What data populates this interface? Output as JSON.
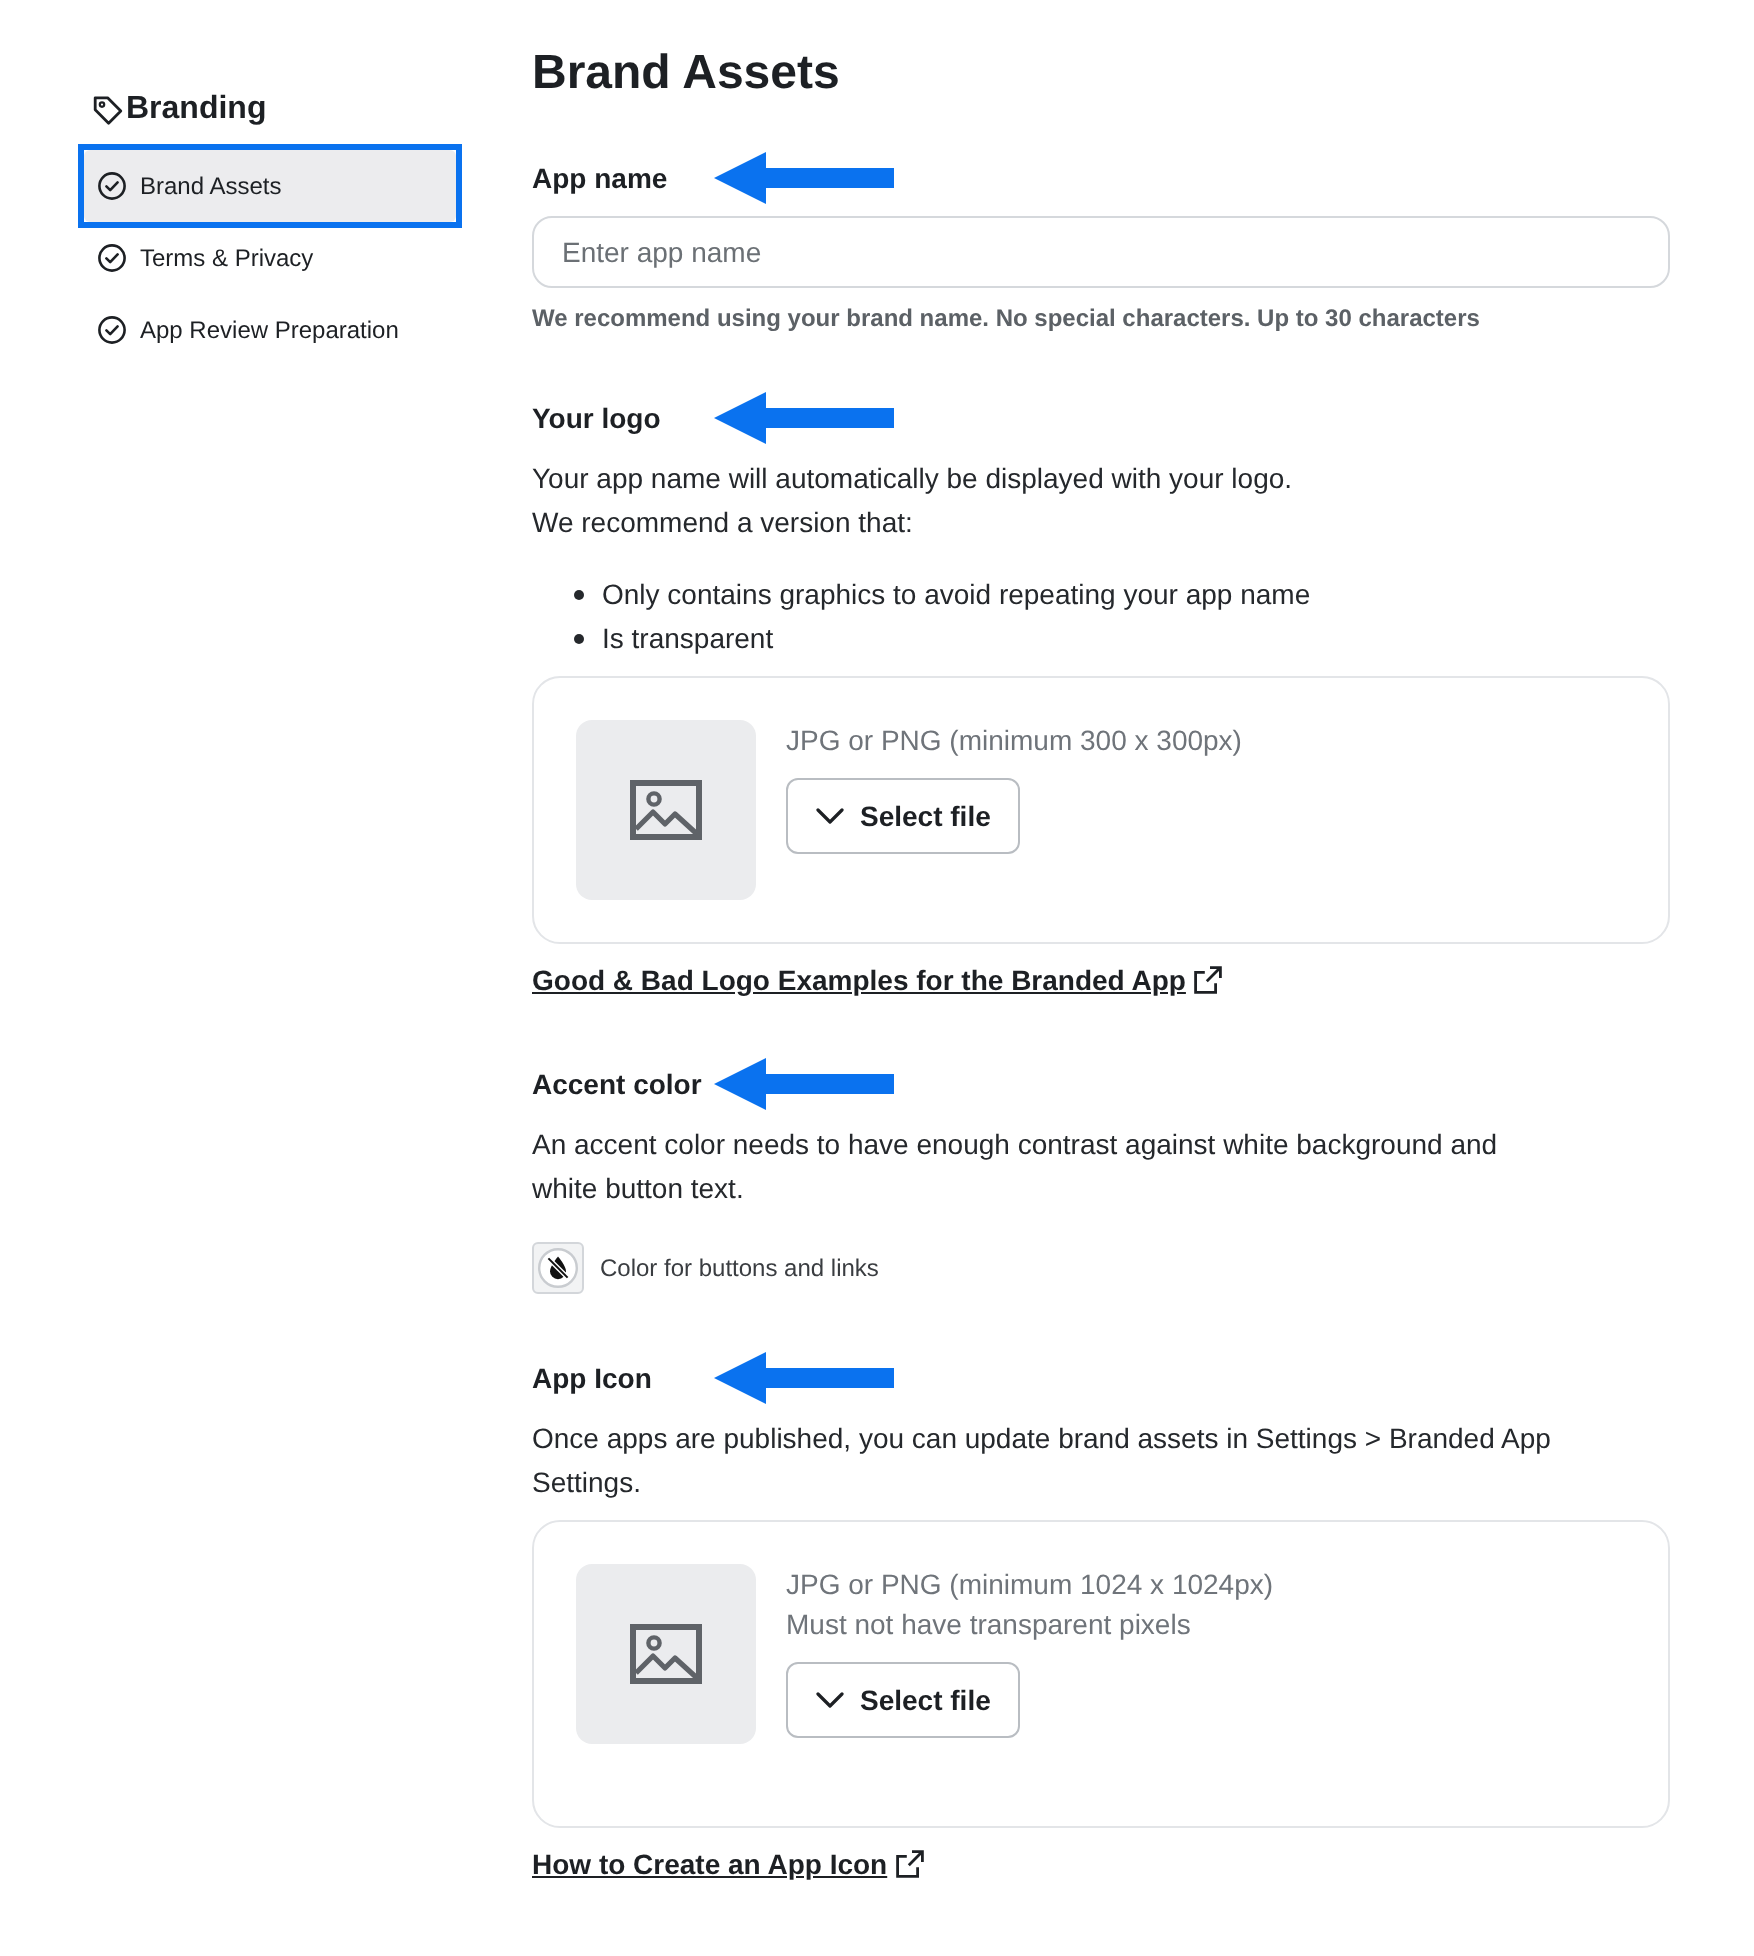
{
  "sidebar": {
    "title": "Branding",
    "items": [
      {
        "label": "Brand Assets",
        "selected": true,
        "highlighted": true
      },
      {
        "label": "Terms & Privacy",
        "selected": false,
        "highlighted": false
      },
      {
        "label": "App Review Preparation",
        "selected": false,
        "highlighted": false
      }
    ]
  },
  "page": {
    "title": "Brand Assets"
  },
  "sections": [
    {
      "kind": "text_input",
      "label": "App name",
      "arrow": true,
      "placeholder": "Enter app name",
      "hint": "We recommend using your brand name. No special characters. Up to 30 characters"
    },
    {
      "kind": "upload",
      "label": "Your logo",
      "arrow": true,
      "description": [
        "Your app name will automatically be displayed with your logo.",
        "We recommend a version that:"
      ],
      "bullets": [
        "Only contains graphics to avoid repeating your app name",
        "Is transparent"
      ],
      "requirements": [
        "JPG or PNG (minimum 300 x 300px)"
      ],
      "button": "Select file",
      "link": "Good & Bad Logo Examples for the Branded App"
    },
    {
      "kind": "color",
      "label": "Accent color",
      "arrow": true,
      "description": [
        "An accent color needs to have enough contrast against white background and white button text."
      ],
      "swatch_label": "Color for buttons and links"
    },
    {
      "kind": "upload",
      "label": "App Icon",
      "arrow": true,
      "description": [
        "Once apps are published, you can update brand assets in Settings > Branded App Settings."
      ],
      "requirements": [
        "JPG or PNG (minimum 1024 x 1024px)",
        "Must not have transparent pixels"
      ],
      "button": "Select file",
      "link": "How to Create an App Icon"
    }
  ]
}
